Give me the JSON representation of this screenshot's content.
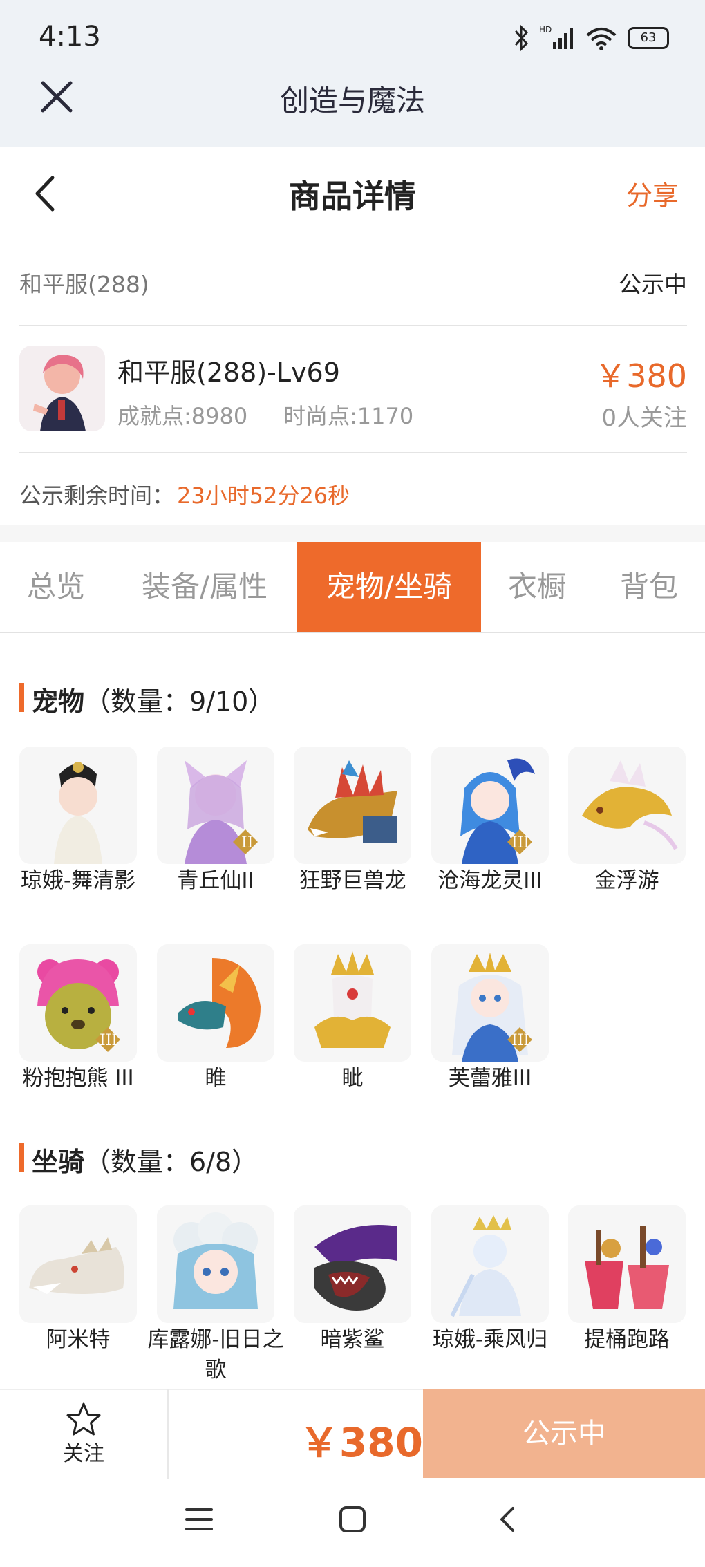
{
  "status_bar": {
    "time": "4:13",
    "battery": "63"
  },
  "app_bar": {
    "title": "创造与魔法"
  },
  "header": {
    "title": "商品详情",
    "share_label": "分享"
  },
  "listing": {
    "account_name": "和平服(288)",
    "status": "公示中",
    "title": "和平服(288)-Lv69",
    "achievement": "成就点:8980",
    "fashion": "时尚点:1170",
    "price": "￥380",
    "followers": "0人关注",
    "remaining_label": "公示剩余时间：",
    "remaining_value": "23小时52分26秒"
  },
  "tabs": [
    {
      "label": "总览"
    },
    {
      "label": "装备/属性"
    },
    {
      "label": "宠物/坐骑",
      "active": true
    },
    {
      "label": "衣橱"
    },
    {
      "label": "背包"
    }
  ],
  "pets": {
    "title": "宠物",
    "count": "（数量：9/10）",
    "items": [
      {
        "name": "琼娥-舞清影"
      },
      {
        "name": "青丘仙II"
      },
      {
        "name": "狂野巨兽龙"
      },
      {
        "name": "沧海龙灵III"
      },
      {
        "name": "金浮游"
      },
      {
        "name": "粉抱抱熊 III"
      },
      {
        "name": "睢"
      },
      {
        "name": "眦"
      },
      {
        "name": "芙蕾雅III"
      }
    ]
  },
  "mounts": {
    "title": "坐骑",
    "count": "（数量：6/8）",
    "items": [
      {
        "name": "阿米特"
      },
      {
        "name": "库露娜-旧日之歌"
      },
      {
        "name": "暗紫鲨"
      },
      {
        "name": "琼娥-乘风归"
      },
      {
        "name": "提桶跑路"
      }
    ]
  },
  "bottom_bar": {
    "follow_label": "关注",
    "price": "￥380",
    "status_button": "公示中"
  },
  "colors": {
    "accent": "#ee6a2b",
    "status_button": "#f2b38f",
    "topbar": "#eef2f6"
  },
  "icons": [
    "bluetooth-icon",
    "signal-icon",
    "wifi-icon",
    "battery-icon",
    "close-icon",
    "back-icon",
    "star-icon",
    "menu-icon",
    "home-icon",
    "nav-back-icon"
  ]
}
